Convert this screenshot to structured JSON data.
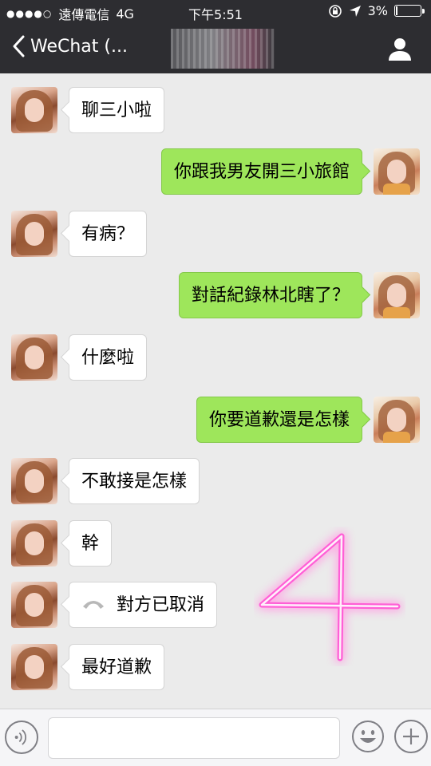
{
  "status_bar": {
    "signal": "●●●●○",
    "carrier": "遠傳電信",
    "network": "4G",
    "time": "下午5:51",
    "battery_text": "3%",
    "battery_level": 0.03
  },
  "nav": {
    "back_label": "WeChat (..."
  },
  "messages": [
    {
      "side": "in",
      "text": "聊三小啦"
    },
    {
      "side": "out",
      "text": "你跟我男友開三小旅館"
    },
    {
      "side": "in",
      "text": "有病？"
    },
    {
      "side": "out",
      "text": "對話紀錄林北瞎了？"
    },
    {
      "side": "in",
      "text": "什麼啦"
    },
    {
      "side": "out",
      "text": "你要道歉還是怎樣"
    },
    {
      "side": "in",
      "text": "不敢接是怎樣"
    },
    {
      "side": "in",
      "text": "幹"
    },
    {
      "side": "in",
      "text": "對方已取消",
      "type": "call"
    },
    {
      "side": "in",
      "text": "最好道歉"
    }
  ],
  "overlay": {
    "neon_text": "4",
    "neon_color": "#ff4fd8"
  },
  "colors": {
    "topbar": "#2d2d31",
    "chat_bg": "#ebebeb",
    "out_bubble": "#9ee65b",
    "in_bubble": "#ffffff"
  },
  "icons": {
    "back": "chevron-left-icon",
    "profile": "person-icon",
    "voice": "voice-icon",
    "emoji": "emoji-icon",
    "plus": "plus-icon",
    "call": "phone-hangup-icon"
  }
}
